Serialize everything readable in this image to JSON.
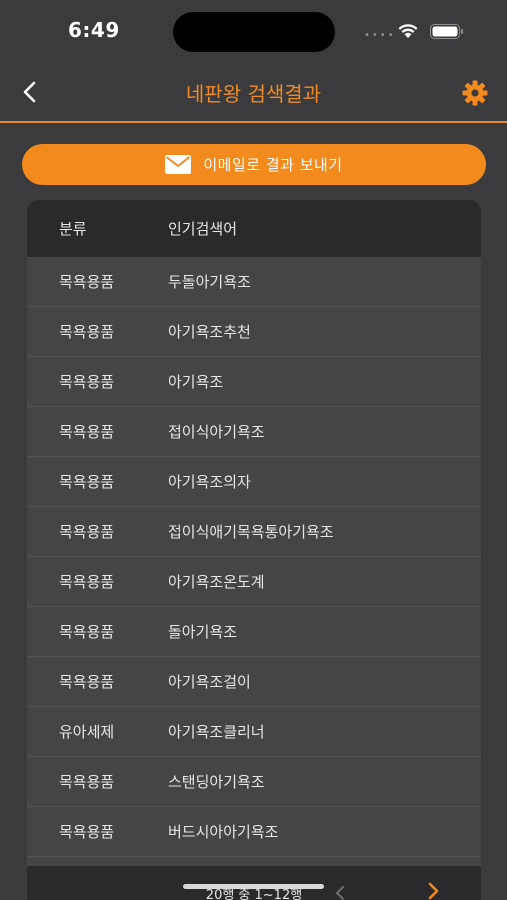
{
  "status_bar": {
    "time": "6:49",
    "dots": "••••"
  },
  "nav": {
    "title": "네판왕 검색결과"
  },
  "actions": {
    "email_label": "이메일로 결과 보내기"
  },
  "table": {
    "headers": {
      "category": "분류",
      "keyword": "인기검색어"
    },
    "rows": [
      {
        "category": "목욕용품",
        "keyword": "두돌아기욕조"
      },
      {
        "category": "목욕용품",
        "keyword": "아기욕조추천"
      },
      {
        "category": "목욕용품",
        "keyword": "아기욕조"
      },
      {
        "category": "목욕용품",
        "keyword": "접이식아기욕조"
      },
      {
        "category": "목욕용품",
        "keyword": "아기욕조의자"
      },
      {
        "category": "목욕용품",
        "keyword": "접이식애기목욕통아기욕조"
      },
      {
        "category": "목욕용품",
        "keyword": "아기욕조온도계"
      },
      {
        "category": "목욕용품",
        "keyword": "돌아기욕조"
      },
      {
        "category": "목욕용품",
        "keyword": "아기욕조걸이"
      },
      {
        "category": "유아세제",
        "keyword": "아기욕조클리너"
      },
      {
        "category": "목욕용품",
        "keyword": "스탠딩아기욕조"
      },
      {
        "category": "목욕용품",
        "keyword": "버드시아아기욕조"
      }
    ],
    "footer": {
      "page_info": "20행 중 1~12행"
    }
  },
  "colors": {
    "accent": "#f28a1e",
    "background": "#3b3b3d",
    "header_bg": "#2a2a2c",
    "row_bg": "#454547",
    "text": "#e6e6e6"
  },
  "icons": {
    "back": "chevron-left-icon",
    "settings": "gear-icon",
    "email": "mail-icon",
    "next": "chevron-right-icon",
    "prev": "chevron-left-icon",
    "wifi": "wifi-icon",
    "battery": "battery-icon"
  }
}
